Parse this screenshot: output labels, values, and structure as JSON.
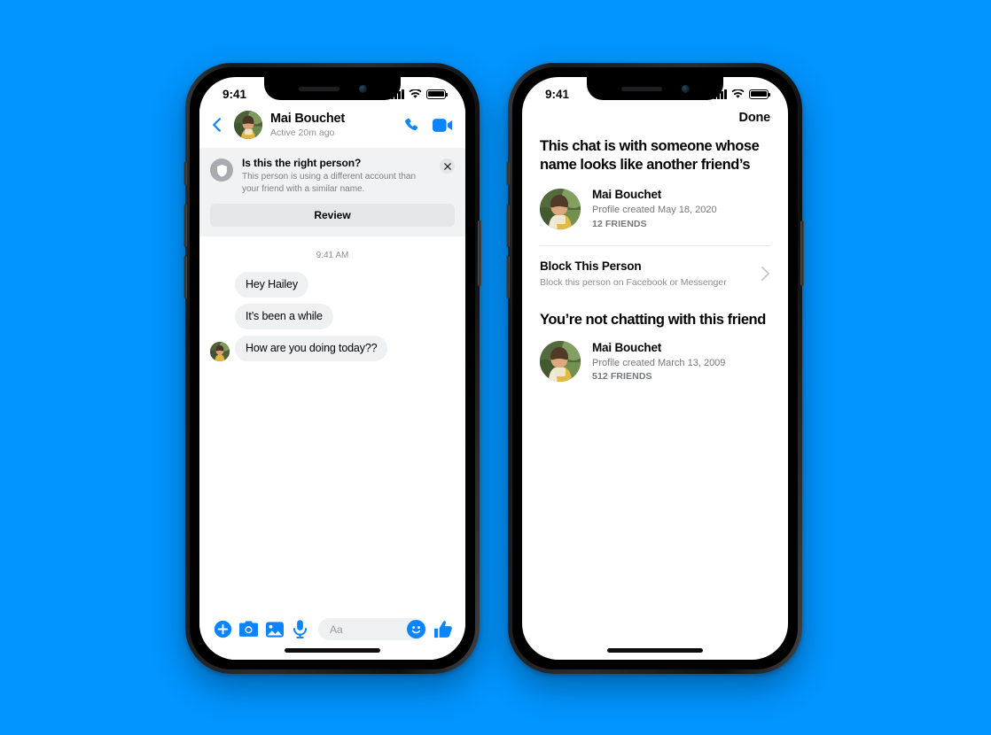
{
  "background_color": "#0095ff",
  "accent_color": "#0a84ff",
  "chat_phone": {
    "status_bar": {
      "time": "9:41",
      "signal_icon": "signal-bars-icon",
      "wifi_icon": "wifi-icon",
      "battery_icon": "battery-icon"
    },
    "header": {
      "back_icon": "chevron-left-icon",
      "avatar": "contact-avatar",
      "name": "Mai Bouchet",
      "status": "Active 20m ago",
      "call_icon": "phone-call-icon",
      "video_icon": "video-camera-icon"
    },
    "warning_banner": {
      "shield_icon": "shield-icon",
      "title": "Is this the right person?",
      "body": "This person is using a different account than your friend with a similar name.",
      "close_icon": "close-x-icon",
      "review_label": "Review"
    },
    "thread": {
      "timestamp": "9:41 AM",
      "messages": [
        {
          "text": "Hey Hailey",
          "show_avatar": false
        },
        {
          "text": "It’s been a while",
          "show_avatar": false
        },
        {
          "text": "How are you doing today??",
          "show_avatar": true
        }
      ]
    },
    "composer": {
      "plus_icon": "plus-circle-icon",
      "camera_icon": "camera-icon",
      "gallery_icon": "image-icon",
      "mic_icon": "microphone-icon",
      "input_placeholder": "Aa",
      "input_value": "",
      "emoji_icon": "smiley-emoji-icon",
      "like_icon": "thumbs-up-icon"
    }
  },
  "review_phone": {
    "status_bar": {
      "time": "9:41",
      "signal_icon": "signal-bars-icon",
      "wifi_icon": "wifi-icon",
      "battery_icon": "battery-icon"
    },
    "nav": {
      "done_label": "Done"
    },
    "section_one": {
      "heading": "This chat is with someone whose name looks like another friend’s",
      "profile": {
        "avatar": "impostor-avatar",
        "name": "Mai Bouchet",
        "created": "Profile created May 18, 2020",
        "friends": "12 FRIENDS"
      },
      "block_row": {
        "title": "Block This Person",
        "subtitle": "Block this person on Facebook or Messenger",
        "chevron_icon": "chevron-right-icon"
      }
    },
    "section_two": {
      "heading": "You’re not chatting with this friend",
      "profile": {
        "avatar": "real-friend-avatar",
        "name": "Mai Bouchet",
        "created": "Profile created March 13, 2009",
        "friends": "512 FRIENDS"
      }
    }
  }
}
